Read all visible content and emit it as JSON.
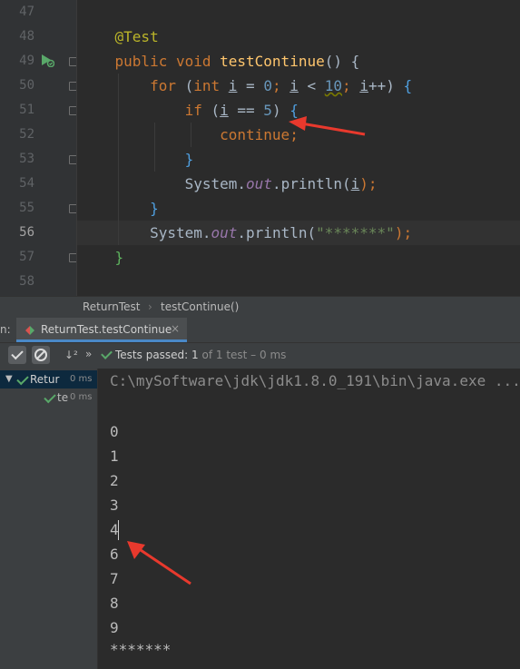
{
  "editor": {
    "line_numbers": [
      "47",
      "48",
      "49",
      "50",
      "51",
      "52",
      "53",
      "54",
      "55",
      "56",
      "57",
      "58"
    ],
    "annotation": "@Test",
    "sig_modifiers": "public void ",
    "sig_method": "testContinue",
    "sig_tail": "() {",
    "for_kw": "for",
    "for_open": " (",
    "for_int": "int",
    "for_i1": "i",
    "for_eq": " = ",
    "for_zero": "0",
    "for_semi1": "; ",
    "for_i2": "i",
    "for_lt": " < ",
    "for_ten": "10",
    "for_semi2": "; ",
    "for_i3": "i",
    "for_inc": "++) ",
    "for_brace": "{",
    "if_kw": "if",
    "if_open": " (",
    "if_i": "i",
    "if_cmp": " == ",
    "if_five": "5",
    "if_close": ") ",
    "if_brace": "{",
    "continue_kw": "continue",
    "continue_semi": ";",
    "close_brace_if": "}",
    "println1_sys": "System.",
    "println1_out": "out",
    "println1_call": ".println(",
    "println1_i": "i",
    "println1_end": ");",
    "close_brace_for": "}",
    "println2_sys": "System.",
    "println2_out": "out",
    "println2_call": ".println(",
    "println2_str": "\"*******\"",
    "println2_end": ");",
    "close_brace_method": "}"
  },
  "breadcrumb": {
    "class": "ReturnTest",
    "separator": "›",
    "method": "testContinue()"
  },
  "run_panel": {
    "left_label": "n:",
    "tab_label": "ReturnTest.testContinue",
    "tab_close": "×"
  },
  "toolbar": {
    "sort_label": "↓²",
    "more": "»",
    "status_bold": "Tests passed: 1",
    "status_rest": " of 1 test – 0 ms"
  },
  "tree": {
    "root_label": "Retur",
    "root_time": "0 ms",
    "child_label": "te",
    "child_time": "0 ms"
  },
  "console": {
    "command": "C:\\mySoftware\\jdk\\jdk1.8.0_191\\bin\\java.exe ...",
    "output": [
      "0",
      "1",
      "2",
      "3",
      "4",
      "6",
      "7",
      "8",
      "9",
      "*******"
    ]
  },
  "colors": {
    "background": "#2b2b2b",
    "keyword": "#cc7832",
    "annotation": "#bbb529",
    "method": "#ffc66d",
    "number": "#6897bb",
    "string": "#6a8759",
    "pass_green": "#59a869",
    "arrow_red": "#e8392d"
  }
}
